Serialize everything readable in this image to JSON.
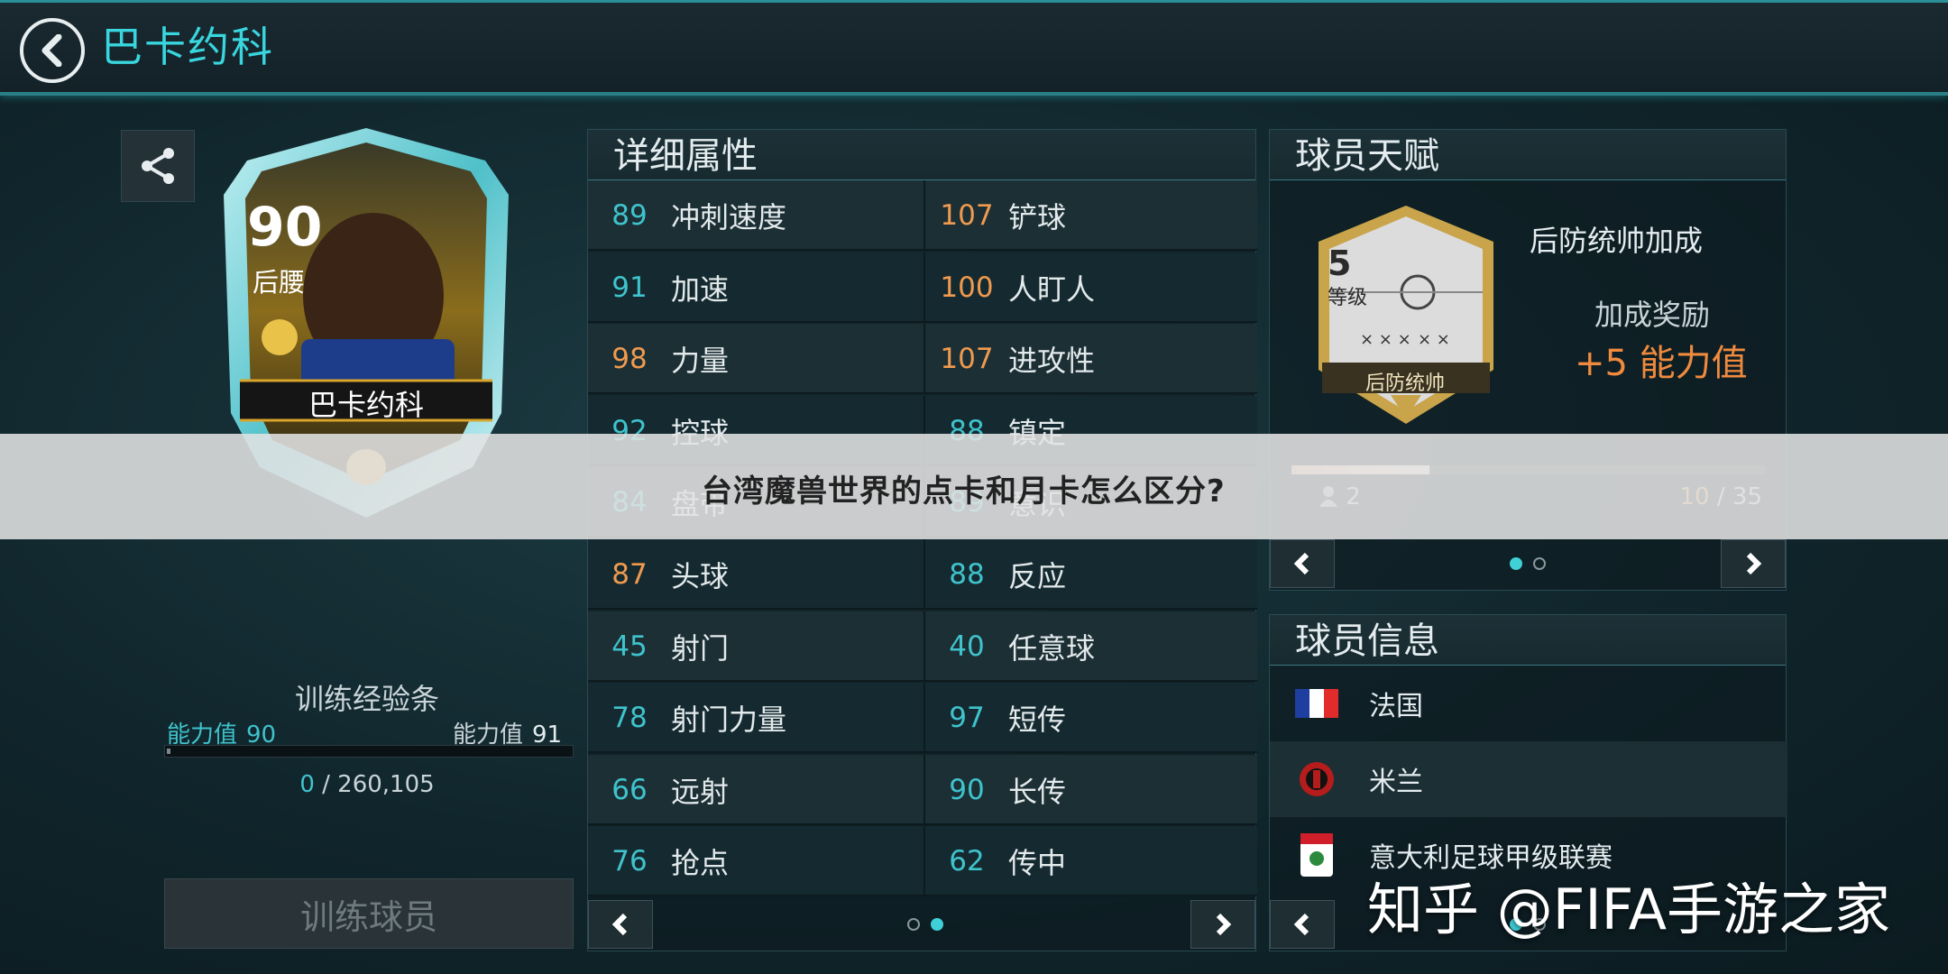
{
  "header": {
    "title": "巴卡约科"
  },
  "card": {
    "rating": "90",
    "position": "后腰",
    "name": "巴卡约科"
  },
  "training": {
    "title": "训练经验条",
    "left_label": "能力值",
    "left_value": "90",
    "right_label": "能力值",
    "right_value": "91",
    "current": "0",
    "separator": "/",
    "total": "260,105",
    "progress": 0,
    "button": "训练球员"
  },
  "attributes": {
    "title": "详细属性",
    "rows": [
      {
        "lv": "89",
        "lc": "teal",
        "ln": "冲刺速度",
        "rv": "107",
        "rc": "orange",
        "rn": "铲球"
      },
      {
        "lv": "91",
        "lc": "teal",
        "ln": "加速",
        "rv": "100",
        "rc": "orange",
        "rn": "人盯人"
      },
      {
        "lv": "98",
        "lc": "orange",
        "ln": "力量",
        "rv": "107",
        "rc": "orange",
        "rn": "进攻性"
      },
      {
        "lv": "92",
        "lc": "teal",
        "ln": "控球",
        "rv": "88",
        "rc": "teal",
        "rn": "镇定"
      },
      {
        "lv": "84",
        "lc": "teal",
        "ln": "盘带",
        "rv": "89",
        "rc": "teal",
        "rn": "意识"
      },
      {
        "lv": "87",
        "lc": "orange",
        "ln": "头球",
        "rv": "88",
        "rc": "teal",
        "rn": "反应"
      },
      {
        "lv": "45",
        "lc": "teal",
        "ln": "射门",
        "rv": "40",
        "rc": "teal",
        "rn": "任意球"
      },
      {
        "lv": "78",
        "lc": "teal",
        "ln": "射门力量",
        "rv": "97",
        "rc": "teal",
        "rn": "短传"
      },
      {
        "lv": "66",
        "lc": "teal",
        "ln": "远射",
        "rv": "90",
        "rc": "teal",
        "rn": "长传"
      },
      {
        "lv": "76",
        "lc": "teal",
        "ln": "抢点",
        "rv": "62",
        "rc": "teal",
        "rn": "传中"
      }
    ]
  },
  "talent": {
    "title": "球员天赋",
    "level": "5",
    "level_label": "等级",
    "badge_name": "后防统帅",
    "name": "后防统帅加成",
    "bonus_label": "加成奖励",
    "bonus_value": "+5 能力值",
    "count": "2",
    "progress_current": "10",
    "progress_sep": " / ",
    "progress_total": "35",
    "progress": 0.29
  },
  "info": {
    "title": "球员信息",
    "nation": "法国",
    "club": "米兰",
    "league": "意大利足球甲级联赛"
  },
  "overlay": {
    "text": "台湾魔兽世界的点卡和月卡怎么区分?"
  },
  "watermark": {
    "text": "知乎 @FIFA手游之家"
  },
  "colors": {
    "accent": "#39d6df",
    "orange": "#ef9a4e",
    "bg": "#0f2127"
  }
}
